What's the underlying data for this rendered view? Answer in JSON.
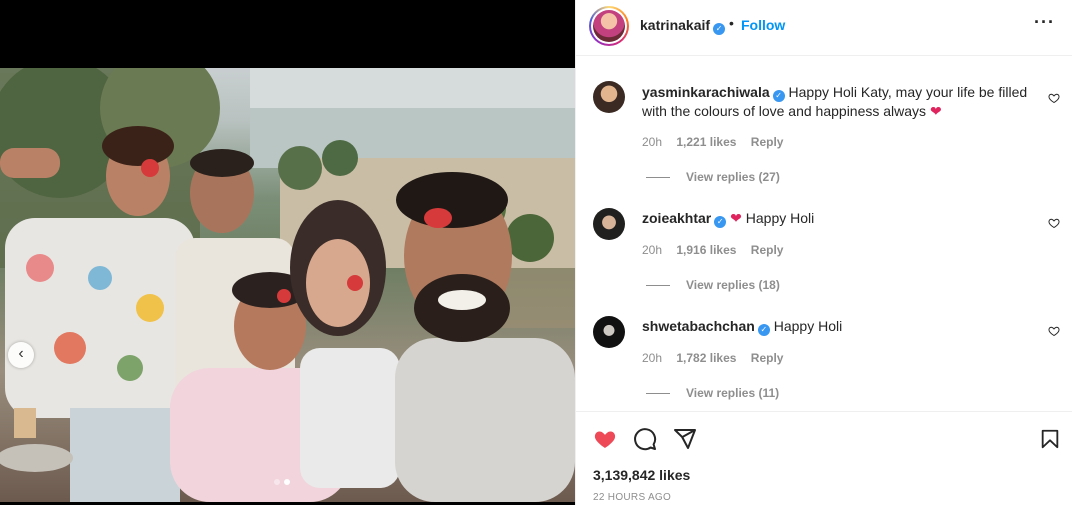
{
  "post": {
    "username": "katrinakaif",
    "separator": "•",
    "follow_label": "Follow",
    "more_label": "···",
    "likes_text": "3,139,842 likes",
    "time_ago": "22 HOURS AGO"
  },
  "carousel": {
    "prev_label": "‹",
    "slide_count": 2,
    "active_slide": 2
  },
  "comments": [
    {
      "username": "yasminkarachiwala",
      "text": "Happy Holi Katy, may your life be filled with the colours of love and happiness always",
      "emoji": "❤",
      "time": "20h",
      "likes": "1,221 likes",
      "reply_label": "Reply",
      "view_replies": "View replies (27)"
    },
    {
      "username": "zoieakhtar",
      "emoji": "❤",
      "text": "Happy Holi",
      "time": "20h",
      "likes": "1,916 likes",
      "reply_label": "Reply",
      "view_replies": "View replies (18)"
    },
    {
      "username": "shwetabachchan",
      "text": "Happy Holi",
      "time": "20h",
      "likes": "1,782 likes",
      "reply_label": "Reply",
      "view_replies": "View replies (11)"
    }
  ],
  "colors": {
    "accent": "#0095f6",
    "verified": "#3897f0",
    "liked_heart": "#ed4956",
    "muted": "#8e8e8e"
  },
  "icons": {
    "like": "heart-filled-icon",
    "comment": "comment-icon",
    "share": "paper-plane-icon",
    "save": "bookmark-icon",
    "verified": "verified-badge-icon",
    "comment_like": "heart-outline-icon"
  }
}
